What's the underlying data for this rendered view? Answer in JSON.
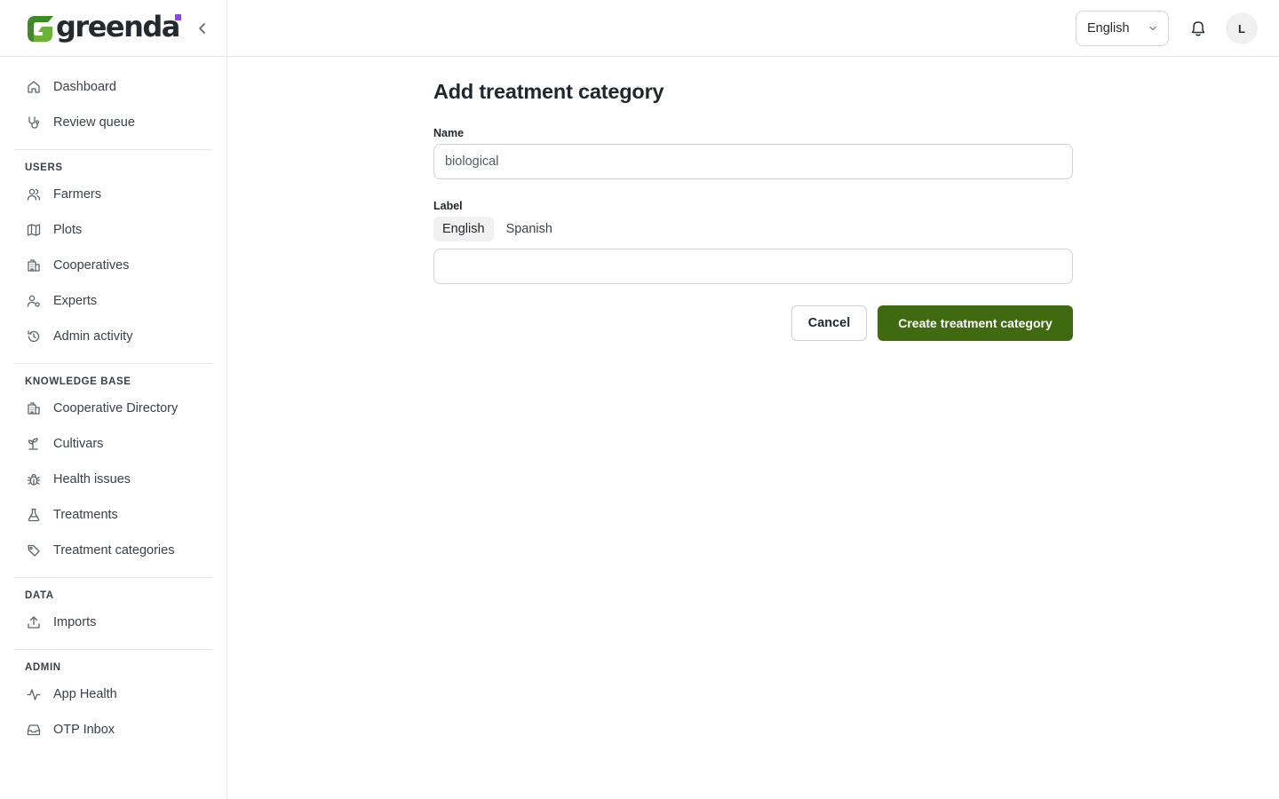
{
  "brand": {
    "name": "greenda",
    "logo_green": "#6bb336",
    "logo_dark_green": "#2f6b1e",
    "dot_color": "#8b45e8"
  },
  "sidebar": {
    "groups": [
      {
        "title": "",
        "items": [
          {
            "label": "Dashboard",
            "icon": "home-icon"
          },
          {
            "label": "Review queue",
            "icon": "stethoscope-icon"
          }
        ]
      },
      {
        "title": "USERS",
        "items": [
          {
            "label": "Farmers",
            "icon": "users-icon"
          },
          {
            "label": "Plots",
            "icon": "map-icon"
          },
          {
            "label": "Cooperatives",
            "icon": "building-icon"
          },
          {
            "label": "Experts",
            "icon": "user-cog-icon"
          },
          {
            "label": "Admin activity",
            "icon": "history-icon"
          }
        ]
      },
      {
        "title": "KNOWLEDGE BASE",
        "items": [
          {
            "label": "Cooperative Directory",
            "icon": "building-icon"
          },
          {
            "label": "Cultivars",
            "icon": "sprout-icon"
          },
          {
            "label": "Health issues",
            "icon": "bug-icon"
          },
          {
            "label": "Treatments",
            "icon": "flask-icon"
          },
          {
            "label": "Treatment categories",
            "icon": "tag-icon"
          }
        ]
      },
      {
        "title": "DATA",
        "items": [
          {
            "label": "Imports",
            "icon": "upload-icon"
          }
        ]
      },
      {
        "title": "ADMIN",
        "items": [
          {
            "label": "App Health",
            "icon": "activity-icon"
          },
          {
            "label": "OTP Inbox",
            "icon": "inbox-icon"
          }
        ]
      }
    ]
  },
  "header": {
    "language": "English",
    "avatar_initial": "L"
  },
  "form": {
    "title": "Add treatment category",
    "name_label": "Name",
    "name_value": "biological",
    "label_label": "Label",
    "tabs": [
      "English",
      "Spanish"
    ],
    "active_tab": "English",
    "label_value": "",
    "cancel": "Cancel",
    "submit": "Create treatment category",
    "primary_color": "#3f6a0f"
  }
}
